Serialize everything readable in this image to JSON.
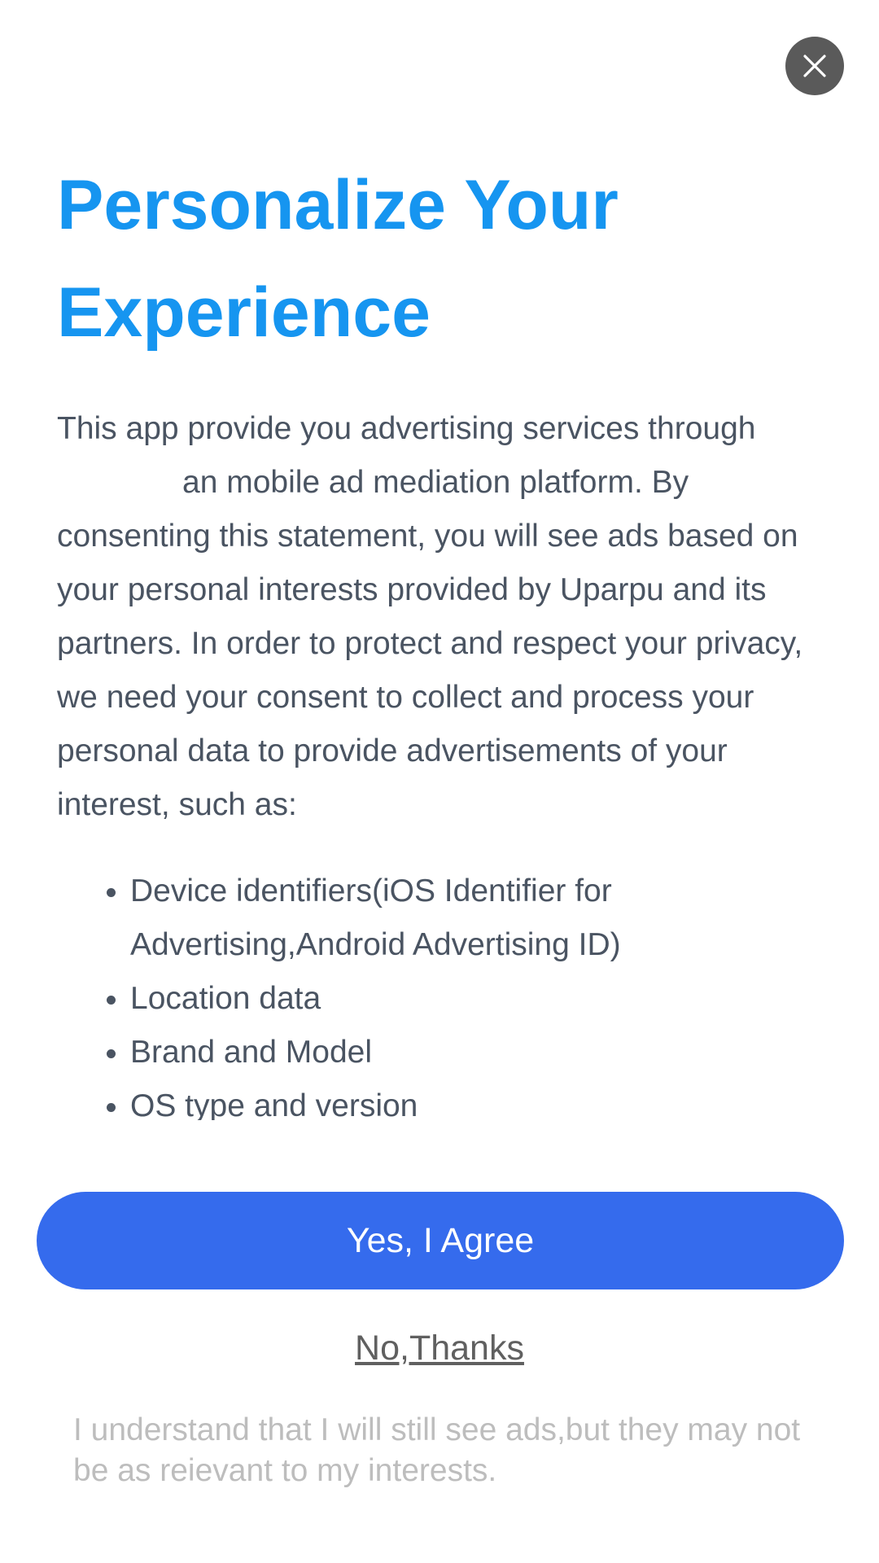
{
  "dialog": {
    "close_icon": "close-icon",
    "title_line1": "Personalize Your",
    "title_line2": "Experience",
    "body_part1": "This app provide you advertising services through",
    "body_part2": "an mobile ad mediation platform. By consenting this statement, you will see ads based on your personal interests provided by Uparpu and its partners. In order to protect and respect your privacy, we need your consent to collect and process your personal data to provide advertisements of your interest, such as:",
    "bullets": [
      "Device identifiers(iOS Identifier for Advertising,Android Advertising ID)",
      "Location data",
      "Brand and Model",
      "OS type and version"
    ],
    "agree_label": "Yes, I Agree",
    "decline_label": "No,Thanks",
    "footnote": "I understand that I will still see ads,but they may not be as reievant to my interests."
  },
  "colors": {
    "title": "#1695f0",
    "agree_button": "#356bed",
    "close_button": "#5a5a5a",
    "body_text": "#4a5462",
    "footnote_text": "#bdbdbd"
  }
}
